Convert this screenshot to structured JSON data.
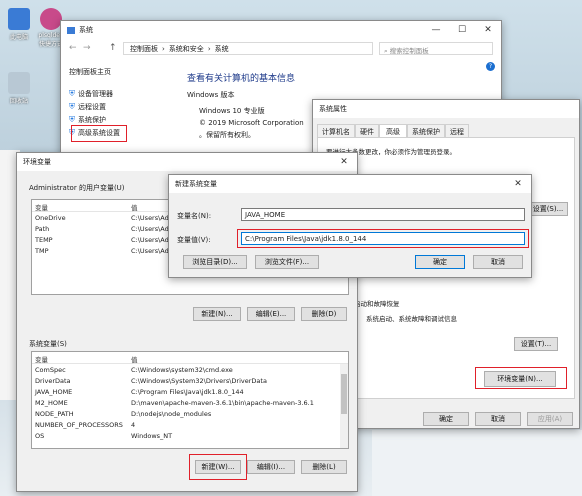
{
  "desktop": {
    "icons": [
      {
        "label": "此电脑"
      },
      {
        "label": "plsqldev\n快捷方式"
      },
      {
        "label": "回收站"
      }
    ]
  },
  "system_window": {
    "title": "系统",
    "breadcrumb": [
      "控制面板",
      "系统和安全",
      "系统"
    ],
    "search_placeholder": "搜索控制面板",
    "sidebar": {
      "home": "控制面板主页",
      "items": [
        "设备管理器",
        "远程设置",
        "系统保护",
        "高级系统设置"
      ]
    },
    "heading": "查看有关计算机的基本信息",
    "section": "Windows 版本",
    "edition": "Windows 10 专业版",
    "copyright": "© 2019 Microsoft Corporation",
    "rights": "。保留所有权利。"
  },
  "sysprops_window": {
    "title": "系统属性",
    "tabs": [
      "计算机名",
      "硬件",
      "高级",
      "系统保护",
      "远程"
    ],
    "notice": "要进行大多数更改，你必须作为管理员登录。",
    "set_btn_1": "设置(S)...",
    "startup_title": "启动和故障恢复",
    "startup_desc": "系统启动、系统故障和调试信息",
    "settings_btn": "设置(T)...",
    "env_btn": "环境变量(N)...",
    "ok": "确定",
    "cancel": "取消",
    "apply": "应用(A)"
  },
  "env_window": {
    "title": "环境变量",
    "user_section": "Administrator 的用户变量(U)",
    "columns": [
      "变量",
      "值"
    ],
    "user_vars": [
      {
        "name": "OneDrive",
        "value": "C:\\Users\\Ad"
      },
      {
        "name": "Path",
        "value": "C:\\Users\\Ad"
      },
      {
        "name": "TEMP",
        "value": "C:\\Users\\Ad"
      },
      {
        "name": "TMP",
        "value": "C:\\Users\\Ad"
      }
    ],
    "user_new": "新建(N)...",
    "user_edit": "编辑(E)...",
    "user_delete": "删除(D)",
    "system_section": "系统变量(S)",
    "system_vars": [
      {
        "name": "ComSpec",
        "value": "C:\\Windows\\system32\\cmd.exe"
      },
      {
        "name": "DriverData",
        "value": "C:\\Windows\\System32\\Drivers\\DriverData"
      },
      {
        "name": "JAVA_HOME",
        "value": "C:\\Program Files\\Java\\jdk1.8.0_144"
      },
      {
        "name": "M2_HOME",
        "value": "D:\\maven\\apache-maven-3.6.1\\bin\\apache-maven-3.6.1"
      },
      {
        "name": "NODE_PATH",
        "value": "D:\\nodejs\\node_modules"
      },
      {
        "name": "NUMBER_OF_PROCESSORS",
        "value": "4"
      },
      {
        "name": "OS",
        "value": "Windows_NT"
      }
    ],
    "sys_new": "新建(W)...",
    "sys_edit": "编辑(I)...",
    "sys_delete": "删除(L)"
  },
  "new_var_dialog": {
    "title": "新建系统变量",
    "name_label": "变量名(N):",
    "name_value": "JAVA_HOME",
    "value_label": "变量值(V):",
    "value_value": "C:\\Program Files\\Java\\jdk1.8.0_144",
    "browse_dir": "浏览目录(D)...",
    "browse_file": "浏览文件(F)...",
    "ok": "确定",
    "cancel": "取消"
  },
  "colors": {
    "highlight": "#e0202a",
    "accent": "#0078d7",
    "link": "#0066cc"
  }
}
